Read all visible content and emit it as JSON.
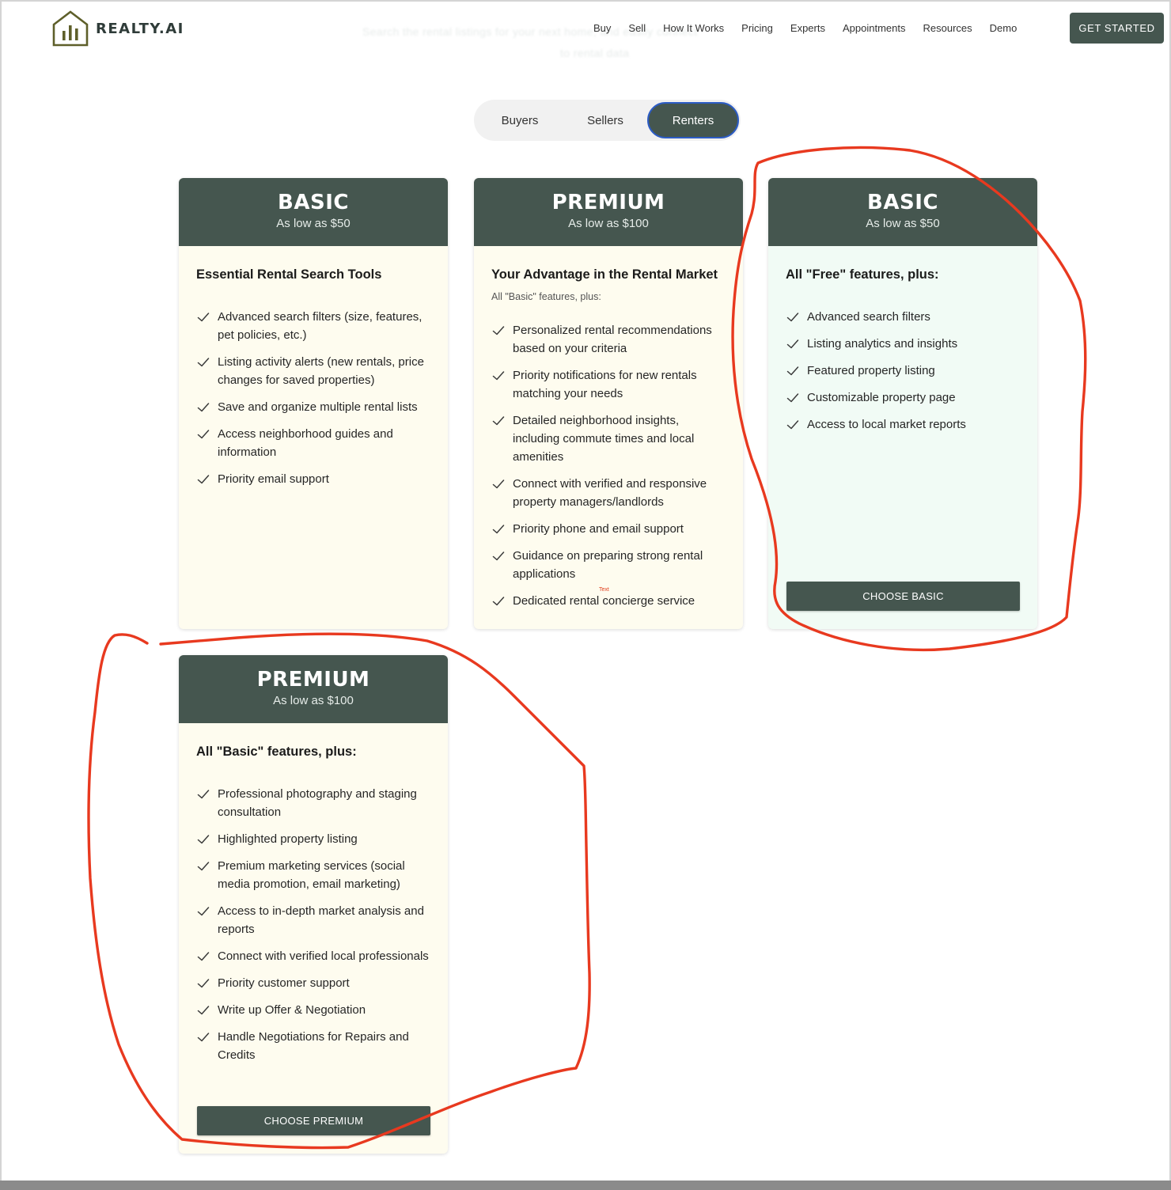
{
  "brand": {
    "name": "REALTY.AI",
    "logo_icon": "house-bar-chart-icon"
  },
  "ghost_text": {
    "line1": "Search the rental listings for your next home, and easily connect",
    "line2": "to rental data"
  },
  "nav": {
    "items": [
      "Buy",
      "Sell",
      "How It Works",
      "Pricing",
      "Experts",
      "Appointments",
      "Resources",
      "Demo"
    ],
    "cta": "GET STARTED"
  },
  "tabs": {
    "items": [
      "Buyers",
      "Sellers",
      "Renters"
    ],
    "active": "Renters"
  },
  "cards": [
    {
      "title": "BASIC",
      "price": "As low as $50",
      "heading": "Essential Rental Search Tools",
      "features": [
        "Advanced search filters (size, features, pet policies, etc.)",
        "Listing activity alerts (new rentals, price changes for saved properties)",
        "Save and organize multiple rental lists",
        "Access neighborhood guides and information",
        "Priority email support"
      ]
    },
    {
      "title": "PREMIUM",
      "price": "As low as $100",
      "heading": "Your Advantage in the Rental Market",
      "subheading": "All \"Basic\" features, plus:",
      "features": [
        "Personalized rental recommendations based on your criteria",
        "Priority notifications for new rentals matching your needs",
        "Detailed neighborhood insights, including commute times and local amenities",
        "Connect with verified and responsive property managers/landlords",
        "Priority phone and email support",
        "Guidance on preparing strong rental applications",
        "Dedicated rental concierge service"
      ],
      "note": "Text"
    },
    {
      "title": "BASIC",
      "price": "As low as $50",
      "heading": "All \"Free\" features, plus:",
      "features": [
        "Advanced search filters",
        "Listing analytics and insights",
        "Featured property listing",
        "Customizable property page",
        "Access to local market reports"
      ],
      "button": "CHOOSE BASIC"
    },
    {
      "title": "PREMIUM",
      "price": "As low as $100",
      "heading": "All \"Basic\" features, plus:",
      "features": [
        "Professional photography and staging consultation",
        "Highlighted property listing",
        "Premium marketing services (social media promotion, email marketing)",
        "Access to in-depth market analysis and reports",
        "Connect with verified local professionals",
        "Priority customer support",
        "Write up Offer & Negotiation",
        "Handle Negotiations for Repairs and Credits"
      ],
      "button": "CHOOSE PREMIUM"
    }
  ],
  "colors": {
    "brand_dark": "#45564f",
    "card_cream": "#fefcef",
    "card_mint": "#f1fbf5",
    "annotation_red": "#e8391f",
    "tab_active_border": "#2c5cc5"
  },
  "icons": {
    "feature_bullet": "check-icon"
  }
}
